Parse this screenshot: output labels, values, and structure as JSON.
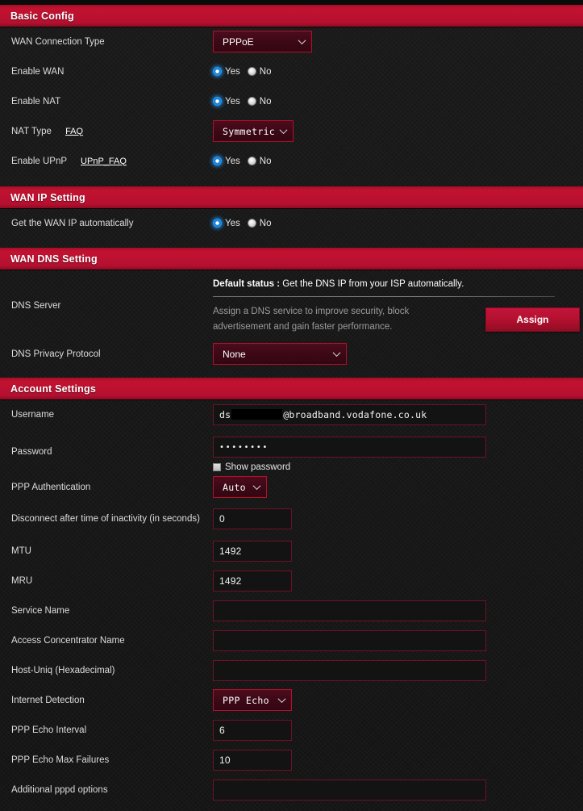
{
  "sections": {
    "basic_config": {
      "title": "Basic Config",
      "wan_connection_type": {
        "label": "WAN Connection Type",
        "value": "PPPoE"
      },
      "enable_wan": {
        "label": "Enable WAN",
        "yes": "Yes",
        "no": "No",
        "selected": "Yes"
      },
      "enable_nat": {
        "label": "Enable NAT",
        "yes": "Yes",
        "no": "No",
        "selected": "Yes"
      },
      "nat_type": {
        "label": "NAT Type",
        "faq": "FAQ",
        "value": "Symmetric"
      },
      "enable_upnp": {
        "label": "Enable UPnP",
        "faq": "UPnP_FAQ",
        "yes": "Yes",
        "no": "No",
        "selected": "Yes"
      }
    },
    "wan_ip_setting": {
      "title": "WAN IP Setting",
      "get_wan_ip_auto": {
        "label": "Get the WAN IP automatically",
        "yes": "Yes",
        "no": "No",
        "selected": "Yes"
      }
    },
    "wan_dns_setting": {
      "title": "WAN DNS Setting",
      "dns_server": {
        "label": "DNS Server",
        "status_prefix": "Default status :",
        "status_text": "Get the DNS IP from your ISP automatically.",
        "description": "Assign a DNS service to improve security, block advertisement and gain faster performance.",
        "assign_button": "Assign"
      },
      "dns_privacy_protocol": {
        "label": "DNS Privacy Protocol",
        "value": "None"
      }
    },
    "account_settings": {
      "title": "Account Settings",
      "username": {
        "label": "Username",
        "value_prefix": "ds",
        "value_suffix": "@broadband.vodafone.co.uk",
        "redacted": true
      },
      "password": {
        "label": "Password",
        "value": "••••••••",
        "show_password_label": "Show password",
        "show_password_checked": false
      },
      "ppp_authentication": {
        "label": "PPP Authentication",
        "value": "Auto"
      },
      "disconnect_inactivity": {
        "label": "Disconnect after time of inactivity (in seconds)",
        "value": "0"
      },
      "mtu": {
        "label": "MTU",
        "value": "1492"
      },
      "mru": {
        "label": "MRU",
        "value": "1492"
      },
      "service_name": {
        "label": "Service Name",
        "value": ""
      },
      "access_concentrator_name": {
        "label": "Access Concentrator Name",
        "value": ""
      },
      "host_uniq": {
        "label": "Host-Uniq (Hexadecimal)",
        "value": ""
      },
      "internet_detection": {
        "label": "Internet Detection",
        "value": "PPP Echo"
      },
      "ppp_echo_interval": {
        "label": "PPP Echo Interval",
        "value": "6"
      },
      "ppp_echo_max_failures": {
        "label": "PPP Echo Max Failures",
        "value": "10"
      },
      "additional_pppd_options": {
        "label": "Additional pppd options",
        "value": ""
      }
    }
  },
  "colors": {
    "header_red": "#c21230",
    "border_crimson": "#b2102c",
    "input_border": "#6d1226",
    "radio_selected": "#1681d8",
    "background": "#1a1a1a"
  }
}
